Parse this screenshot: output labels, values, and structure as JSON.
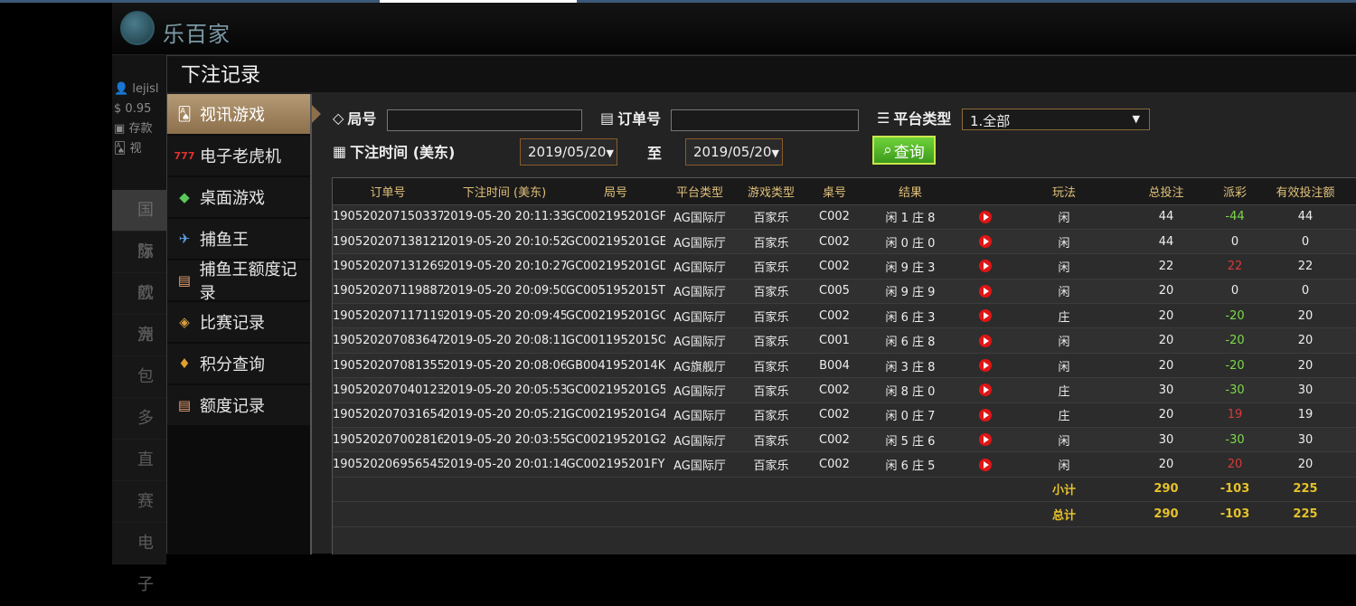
{
  "site": {
    "logo_text": "乐百家",
    "user_name": "lejisl",
    "balance": "0.95",
    "deposit_label": "存款",
    "game_label": "视"
  },
  "bg_menu": [
    "国际",
    "旗舰",
    "欧洲",
    "竞",
    "包",
    "多",
    "直",
    "赛",
    "电子"
  ],
  "modal": {
    "title": "下注记录"
  },
  "sidebar": {
    "items": [
      {
        "label": "视讯游戏",
        "icon": "playing-cards-icon",
        "active": true
      },
      {
        "label": "电子老虎机",
        "icon": "slot-777-icon",
        "active": false
      },
      {
        "label": "桌面游戏",
        "icon": "chips-icon",
        "active": false
      },
      {
        "label": "捕鱼王",
        "icon": "fish-icon",
        "active": false
      },
      {
        "label": "捕鱼王额度记录",
        "icon": "document-icon",
        "active": false
      },
      {
        "label": "比赛记录",
        "icon": "ticket-icon",
        "active": false
      },
      {
        "label": "积分查询",
        "icon": "diamond-icon",
        "active": false
      },
      {
        "label": "额度记录",
        "icon": "document-icon",
        "active": false
      }
    ]
  },
  "filters": {
    "round_label": "局号",
    "round_value": "",
    "order_label": "订单号",
    "order_value": "",
    "platform_label": "平台类型",
    "platform_value": "1.全部",
    "time_label": "下注时间 (美东)",
    "date_from": "2019/05/20",
    "to_label": "至",
    "date_to": "2019/05/20",
    "query_label": "查询"
  },
  "table": {
    "headers": [
      "订单号",
      "下注时间 (美东)",
      "局号",
      "平台类型",
      "游戏类型",
      "桌号",
      "结果",
      "",
      "玩法",
      "总投注",
      "派彩",
      "有效投注额"
    ],
    "rows": [
      [
        "190520207150337",
        "2019-05-20 20:11:33",
        "GC002195201GF",
        "AG国际厅",
        "百家乐",
        "C002",
        "闲 1 庄 8",
        "闲",
        "44",
        "-44",
        "44"
      ],
      [
        "190520207138121",
        "2019-05-20 20:10:52",
        "GC002195201GE",
        "AG国际厅",
        "百家乐",
        "C002",
        "闲 0 庄 0",
        "闲",
        "44",
        "0",
        "0"
      ],
      [
        "190520207131269",
        "2019-05-20 20:10:27",
        "GC002195201GD",
        "AG国际厅",
        "百家乐",
        "C002",
        "闲 9 庄 3",
        "闲",
        "22",
        "22",
        "22"
      ],
      [
        "190520207119887",
        "2019-05-20 20:09:50",
        "GC0051952015T",
        "AG国际厅",
        "百家乐",
        "C005",
        "闲 9 庄 9",
        "闲",
        "20",
        "0",
        "0"
      ],
      [
        "190520207117119",
        "2019-05-20 20:09:45",
        "GC002195201GC",
        "AG国际厅",
        "百家乐",
        "C002",
        "闲 6 庄 3",
        "庄",
        "20",
        "-20",
        "20"
      ],
      [
        "190520207083647",
        "2019-05-20 20:08:11",
        "GC0011952015O",
        "AG国际厅",
        "百家乐",
        "C001",
        "闲 6 庄 8",
        "闲",
        "20",
        "-20",
        "20"
      ],
      [
        "190520207081355",
        "2019-05-20 20:08:06",
        "GB0041952014K",
        "AG旗舰厅",
        "百家乐",
        "B004",
        "闲 3 庄 8",
        "闲",
        "20",
        "-20",
        "20"
      ],
      [
        "190520207040123",
        "2019-05-20 20:05:53",
        "GC002195201G5",
        "AG国际厅",
        "百家乐",
        "C002",
        "闲 8 庄 0",
        "庄",
        "30",
        "-30",
        "30"
      ],
      [
        "190520207031654",
        "2019-05-20 20:05:21",
        "GC002195201G4",
        "AG国际厅",
        "百家乐",
        "C002",
        "闲 0 庄 7",
        "庄",
        "20",
        "19",
        "19"
      ],
      [
        "190520207002816",
        "2019-05-20 20:03:55",
        "GC002195201G2",
        "AG国际厅",
        "百家乐",
        "C002",
        "闲 5 庄 6",
        "闲",
        "30",
        "-30",
        "30"
      ],
      [
        "190520206956545",
        "2019-05-20 20:01:14",
        "GC002195201FY",
        "AG国际厅",
        "百家乐",
        "C002",
        "闲 6 庄 5",
        "闲",
        "20",
        "20",
        "20"
      ]
    ],
    "subtotal": {
      "label": "小计",
      "total_bet": "290",
      "payout": "-103",
      "valid": "225"
    },
    "total": {
      "label": "总计",
      "total_bet": "290",
      "payout": "-103",
      "valid": "225"
    }
  },
  "colors": {
    "accent": "#a88a64",
    "negative": "#7cd94a",
    "positive": "#d83a3a",
    "summary": "#e6c22a",
    "query_button": "#4fb52a"
  }
}
